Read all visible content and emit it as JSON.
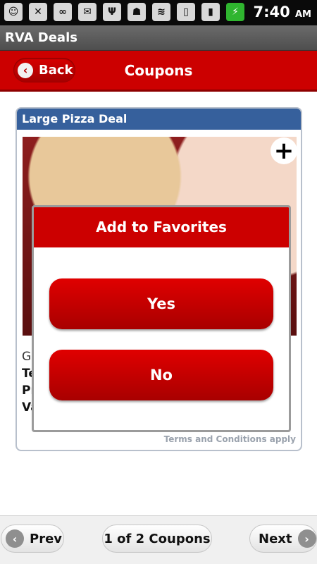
{
  "status_bar": {
    "icons": [
      "sms-icon",
      "missed-call-icon",
      "voicemail-icon",
      "email-icon",
      "usb-icon",
      "android-debug-icon",
      "wifi-icon",
      "vibrate-icon",
      "signal-icon",
      "battery-charging-icon"
    ],
    "time": "7:40",
    "ampm": "AM"
  },
  "app_bar": {
    "title": "RVA Deals"
  },
  "header": {
    "back_label": "Back",
    "title": "Coupons"
  },
  "coupon": {
    "title": "Large Pizza Deal",
    "line1": "Ge",
    "line2": "Te",
    "line3": "Pr",
    "line4": "Va",
    "terms": "Terms and Conditions apply"
  },
  "dialog": {
    "title": "Add to Favorites",
    "yes_label": "Yes",
    "no_label": "No"
  },
  "pager": {
    "prev_label": "Prev",
    "count_label": "1 of 2 Coupons",
    "next_label": "Next"
  }
}
